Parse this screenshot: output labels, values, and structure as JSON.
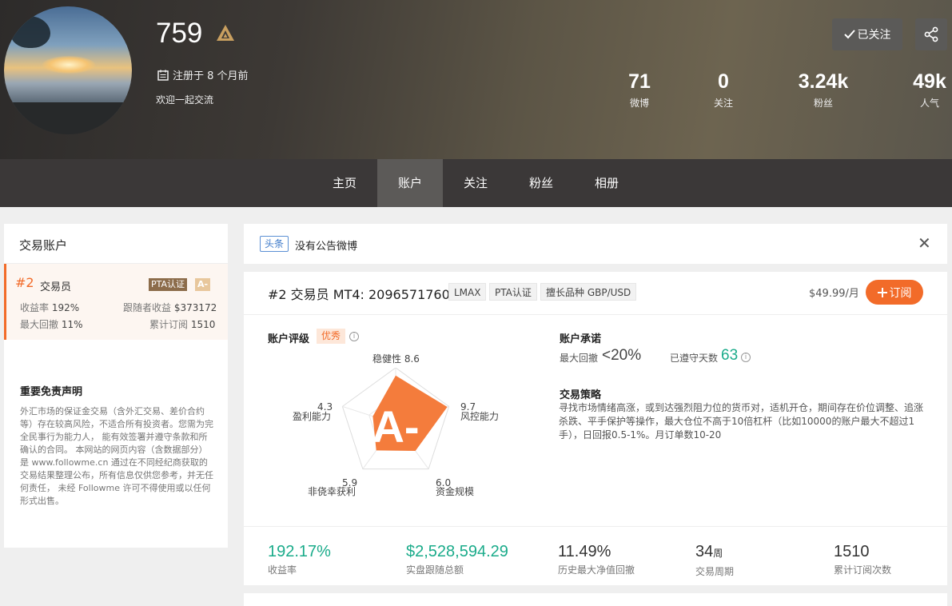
{
  "profile": {
    "username": "759",
    "registered": "注册于 8 个月前",
    "bio": "欢迎一起交流",
    "follow_label": "已关注"
  },
  "stats": [
    {
      "value": "71",
      "label": "微博"
    },
    {
      "value": "0",
      "label": "关注"
    },
    {
      "value": "3.24k",
      "label": "粉丝"
    },
    {
      "value": "49k",
      "label": "人气"
    }
  ],
  "tabs": [
    "主页",
    "账户",
    "关注",
    "粉丝",
    "相册"
  ],
  "active_tab": "账户",
  "sidebar": {
    "title": "交易账户",
    "trader": {
      "rank": "#2",
      "label": "交易员",
      "pta": "PTA认证",
      "grade": "A-",
      "return_label": "收益率",
      "return_value": "192%",
      "follower_profit_label": "跟随者收益",
      "follower_profit_value": "$373172",
      "drawdown_label": "最大回撤",
      "drawdown_value": "11%",
      "subs_label": "累计订阅",
      "subs_value": "1510"
    },
    "disclaimer_title": "重要免责声明",
    "disclaimer_body": "外汇市场的保证金交易（含外汇交易、差价合约等）存在较高风险，不适合所有投资者。您需为完全民事行为能力人， 能有效签署并遵守条款和所确认的合同。 本网站的网页内容（含数据部分）是 www.followme.cn 通过在不同经纪商获取的交易结果整理公布，所有信息仅供您参考，并无任何责任， 未经 Followme 许可不得使用或以任何形式出售。"
  },
  "headline": {
    "tag": "头条",
    "text": "没有公告微博",
    "close": "✕"
  },
  "account": {
    "title": "#2 交易员 MT4: 2096571760",
    "chips": [
      "LMAX",
      "PTA认证",
      "擅长品种 GBP/USD"
    ],
    "price": "$49.99/月",
    "subscribe_label": "订阅",
    "rating_title": "账户评级",
    "rating_tag": "优秀",
    "grade": "A-",
    "radar": [
      {
        "name": "稳健性",
        "value": 8.6
      },
      {
        "name": "风控能力",
        "value": 9.7
      },
      {
        "name": "资金规模",
        "value": 6.0
      },
      {
        "name": "非侥幸获利",
        "value": 5.9
      },
      {
        "name": "盈利能力",
        "value": 4.3
      }
    ],
    "radar_labels": {
      "stability": "稳健性 8.6",
      "risk_value": "9.7",
      "risk_name": "风控能力",
      "capital_value": "6.0",
      "capital_name": "资金规模",
      "luck_value": "5.9",
      "luck_name": "非侥幸获利",
      "profit_value": "4.3",
      "profit_name": "盈利能力"
    },
    "promise_title": "账户承诺",
    "max_dd_label": "最大回撤",
    "max_dd_value": "<20%",
    "days_label": "已遵守天数",
    "days_value": "63",
    "strategy_title": "交易策略",
    "strategy_text": "寻找市场情绪高涨，或到达强烈阻力位的货币对，适机开仓，期间存在价位调整、追涨杀跌、平手保护等操作，最大仓位不高于10倍杠杆（比如10000的账户最大不超过1手），日回报0.5-1%。月订单数10-20"
  },
  "bottom_stats": [
    {
      "value": "192.17%",
      "label": "收益率",
      "color": "#1aab8a"
    },
    {
      "value": "$2,528,594.29",
      "label": "实盘跟随总额",
      "color": "#1aab8a"
    },
    {
      "value": "11.49%",
      "label": "历史最大净值回撤",
      "color": "#333"
    },
    {
      "value": "34",
      "unit": "周",
      "label": "交易周期",
      "color": "#333"
    },
    {
      "value": "1510",
      "label": "累计订阅次数",
      "color": "#333"
    }
  ],
  "colors": {
    "accent": "#f26b29",
    "green": "#1aab8a",
    "radar_fill": "#f47c3c"
  }
}
